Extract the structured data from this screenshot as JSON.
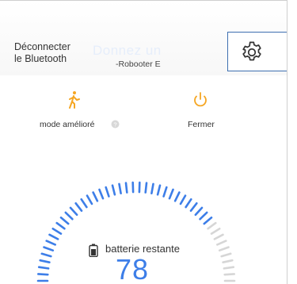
{
  "header": {
    "disconnect_label": "Déconnecter\nle Bluetooth",
    "device_title": "Donnez un",
    "device_name": "-Robooter E"
  },
  "controls": {
    "mode_label": "mode amélioré",
    "power_label": "Fermer"
  },
  "battery": {
    "label": "batterie restante",
    "value": "78",
    "level_fraction": 0.78
  },
  "colors": {
    "accent_orange": "#f5a623",
    "gauge_blue": "#3d7ee8",
    "gauge_grey": "#d6d6d6"
  },
  "icons": {
    "settings": "gear-icon",
    "mode": "walking-person-icon",
    "help": "help-icon",
    "power": "power-icon",
    "battery": "battery-icon"
  }
}
